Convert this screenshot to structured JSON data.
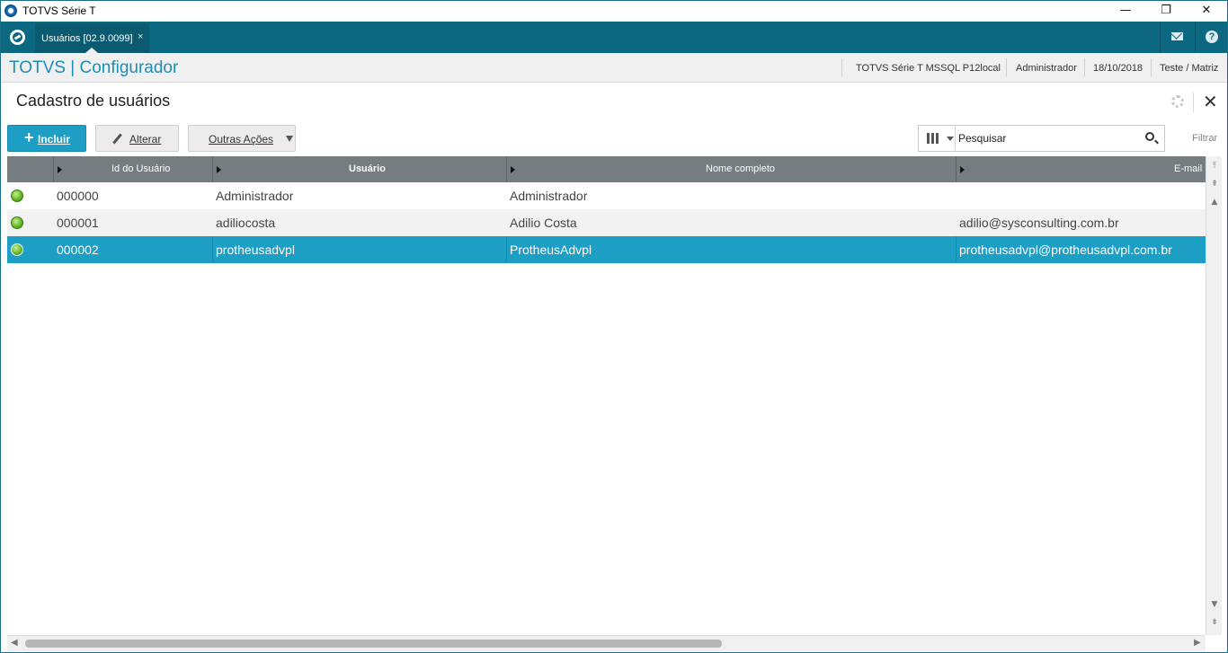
{
  "window": {
    "title": "TOTVS Série T",
    "minimize": "—",
    "restore": "❐",
    "close": "✕"
  },
  "tabbar": {
    "tab_label": "Usuários [02.9.0099]",
    "tab_close": "×",
    "help_glyph": "?"
  },
  "header": {
    "brand": "TOTVS | Configurador",
    "environment": "TOTVS Série T  MSSQL P12local",
    "user": "Administrador",
    "date": "18/10/2018",
    "company": "Teste / Matriz"
  },
  "page": {
    "title": "Cadastro de usuários",
    "close_glyph": "✕"
  },
  "toolbar": {
    "include_label": "Incluir",
    "alter_label": "Alterar",
    "other_actions_label": "Outras Ações",
    "search_placeholder": "Pesquisar",
    "filter_label": "Filtrar"
  },
  "grid": {
    "columns": [
      "Id do Usuário",
      "Usuário",
      "Nome completo",
      "E-mail"
    ],
    "rows": [
      {
        "status": "active",
        "id": "000000",
        "user": "Administrador",
        "name": "Administrador",
        "email": ""
      },
      {
        "status": "active",
        "id": "000001",
        "user": "adiliocosta",
        "name": "Adilio Costa",
        "email": "adilio@sysconsulting.com.br"
      },
      {
        "status": "active",
        "id": "000002",
        "user": "protheusadvpl",
        "name": "ProtheusAdvpl",
        "email": "protheusadvpl@protheusadvpl.com.br"
      }
    ],
    "selected_row": 2
  },
  "colors": {
    "tabbar": "#0c6780",
    "accent": "#1d9ec4",
    "grid_header": "#757d80",
    "status_active": "#5fb320"
  }
}
